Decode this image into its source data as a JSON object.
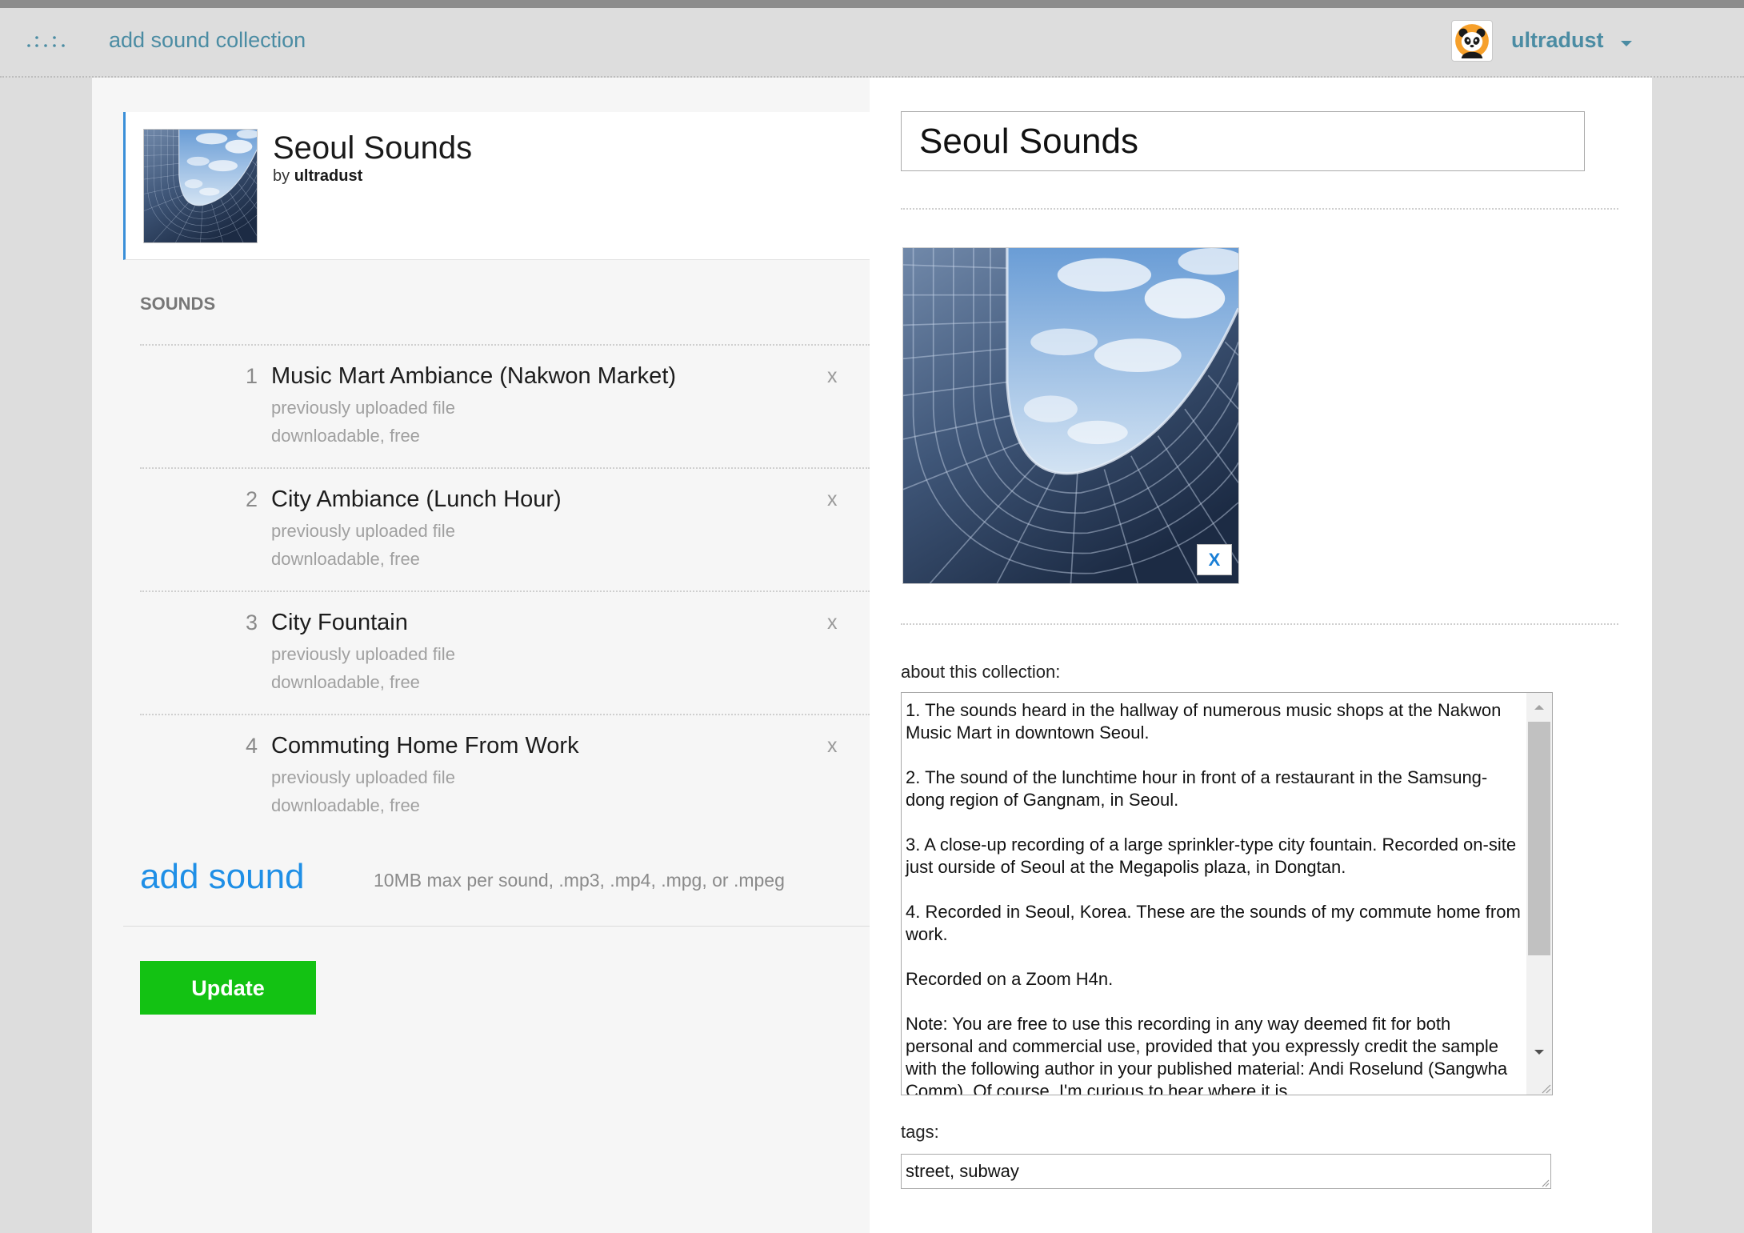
{
  "header": {
    "nav_label": "add sound collection",
    "username": "ultradust",
    "logo_icon": "dots-logo-icon",
    "avatar_icon": "panda-avatar-icon",
    "menu_icon": "caret-down-icon"
  },
  "collection": {
    "title": "Seoul Sounds",
    "by_prefix": "by",
    "author": "ultradust"
  },
  "sounds": {
    "heading": "SOUNDS",
    "items": [
      {
        "number": "1",
        "title": "Music Mart Ambiance (Nakwon Market)",
        "source": "previously uploaded file",
        "license": "downloadable, free",
        "remove_label": "x"
      },
      {
        "number": "2",
        "title": "City Ambiance (Lunch Hour)",
        "source": "previously uploaded file",
        "license": "downloadable, free",
        "remove_label": "x"
      },
      {
        "number": "3",
        "title": "City Fountain",
        "source": "previously uploaded file",
        "license": "downloadable, free",
        "remove_label": "x"
      },
      {
        "number": "4",
        "title": "Commuting Home From Work",
        "source": "previously uploaded file",
        "license": "downloadable, free",
        "remove_label": "x"
      }
    ]
  },
  "add_sound": {
    "label": "add sound",
    "hint": "10MB max per sound, .mp3, .mp4, .mpg, or .mpeg"
  },
  "actions": {
    "update_label": "Update"
  },
  "form": {
    "title_value": "Seoul Sounds",
    "remove_image_label": "X",
    "about_label": "about this collection:",
    "about_value": "1. The sounds heard in the hallway of numerous music shops at the Nakwon Music Mart in downtown Seoul.\n\n2. The sound of the lunchtime hour in front of a restaurant in the Samsung-dong region of Gangnam, in Seoul.\n\n3. A close-up recording of a large sprinkler-type city fountain. Recorded on-site just ourside of Seoul at the Megapolis plaza, in Dongtan.\n\n4. Recorded in Seoul, Korea. These are the sounds of my commute home from work.\n\nRecorded on a Zoom H4n.\n\nNote: You are free to use this recording in any way deemed fit for both personal and commercial use, provided that you expressly credit the sample with the following author in your published material: Andi Roselund (Sangwha Comm). Of course, I'm curious to hear where it is",
    "tags_label": "tags:",
    "tags_value": "street, subway"
  },
  "colors": {
    "header_bg": "#dddddd",
    "nav_link": "#4b8ca3",
    "accent_blue": "#1f8fe6",
    "update_green": "#13c213",
    "card_border": "#3a8fd8",
    "panel_left_bg": "#f6f6f6"
  }
}
